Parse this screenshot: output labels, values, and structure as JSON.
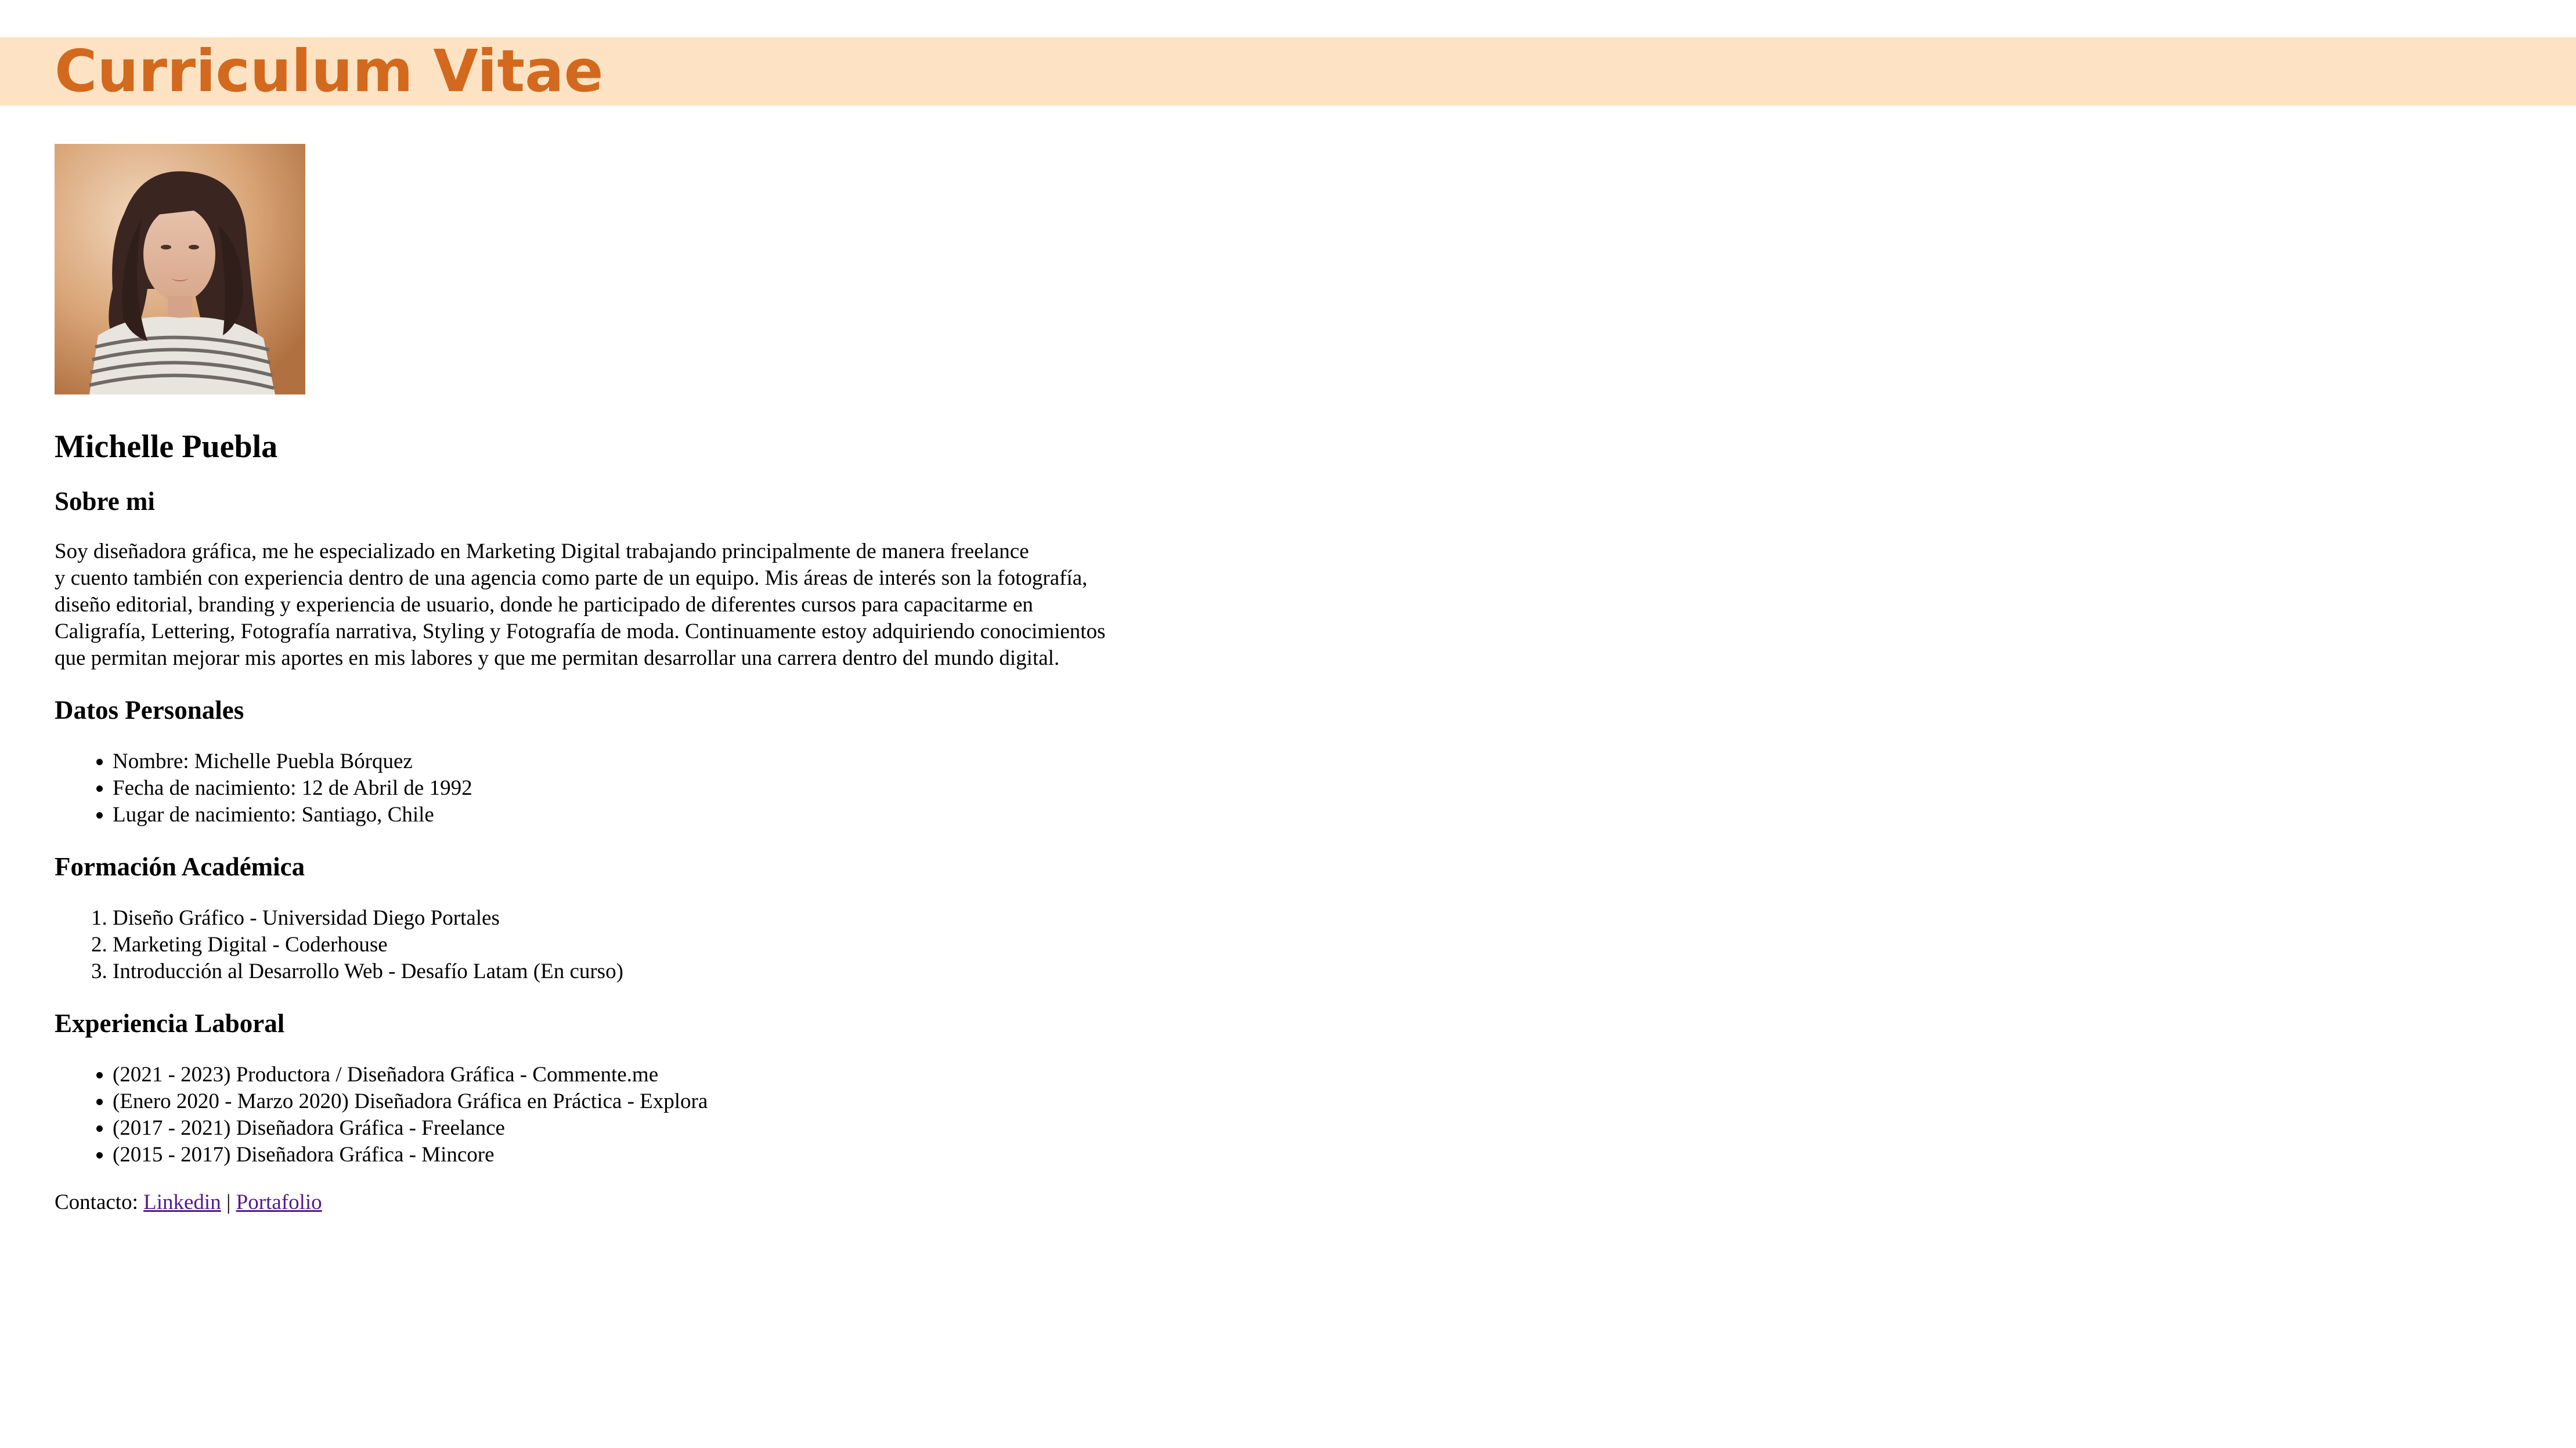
{
  "header": {
    "title": "Curriculum Vitae"
  },
  "profile": {
    "name": "Michelle Puebla"
  },
  "about": {
    "heading": "Sobre mi",
    "lines": [
      "Soy diseñadora gráfica, me he especializado en Marketing Digital trabajando principalmente de manera freelance",
      "y cuento también con experiencia dentro de una agencia como parte de un equipo. Mis áreas de interés son la fotografía,",
      "diseño editorial, branding y experiencia de usuario, donde he participado de diferentes cursos para capacitarme en",
      "Caligrafía, Lettering, Fotografía narrativa, Styling y Fotografía de moda. Continuamente estoy adquiriendo conocimientos",
      "que permitan mejorar mis aportes en mis labores y que me permitan desarrollar una carrera dentro del mundo digital."
    ]
  },
  "personal": {
    "heading": "Datos Personales",
    "items": [
      "Nombre: Michelle Puebla Bórquez",
      "Fecha de nacimiento: 12 de Abril de 1992",
      "Lugar de nacimiento: Santiago, Chile"
    ]
  },
  "education": {
    "heading": "Formación Académica",
    "items": [
      "Diseño Gráfico - Universidad Diego Portales",
      "Marketing Digital - Coderhouse",
      "Introducción al Desarrollo Web - Desafío Latam (En curso)"
    ]
  },
  "work": {
    "heading": "Experiencia Laboral",
    "items": [
      "(2021 - 2023) Productora / Diseñadora Gráfica - Commente.me",
      "(Enero 2020 - Marzo 2020) Diseñadora Gráfica en Práctica - Explora",
      "(2017 - 2021) Diseñadora Gráfica - Freelance",
      "(2015 - 2017) Diseñadora Gráfica - Mincore"
    ]
  },
  "contact": {
    "label": "Contacto:",
    "separator": "|",
    "linkedin_label": "Linkedin",
    "portfolio_label": "Portafolio"
  },
  "colors": {
    "header_band": "#fde3c3",
    "title": "#d2691e",
    "visited_link": "#551a8b"
  }
}
